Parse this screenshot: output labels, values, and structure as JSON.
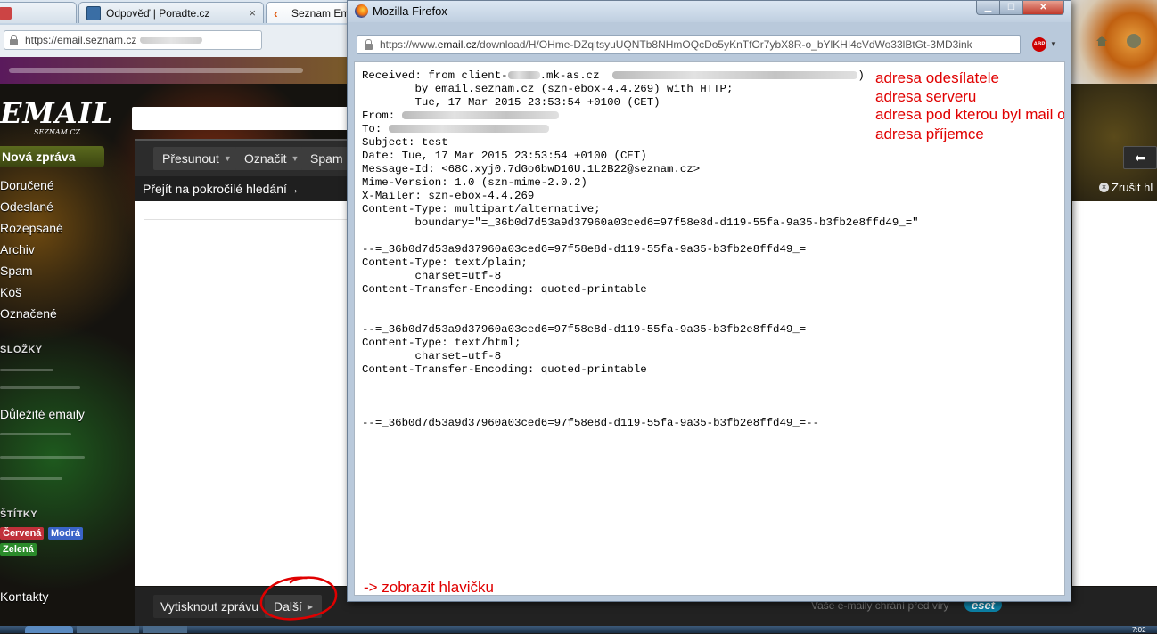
{
  "background_browser": {
    "tabs": [
      {
        "label": "",
        "favicon_color": "#cc4444"
      },
      {
        "label": "Odpověď | Poradte.cz",
        "favicon_color": "#3a6ea5"
      },
      {
        "label": "Seznam Em",
        "favicon_color": "#e05a10"
      }
    ],
    "tab_close_glyph": "×",
    "url": "https://email.seznam.cz"
  },
  "email_app": {
    "logo_main": "EMAIL",
    "logo_sub": "SEZNAM.CZ",
    "toolbar": {
      "move_label": "Přesunout",
      "mark_label": "Označit",
      "spam_label": "Spam"
    },
    "advanced_search_link": "Přejít na pokročilé hledání→",
    "cancel_search_label": "Zrušit hl",
    "new_mail_label": "Nová zpráva",
    "folders": [
      "Doručené",
      "Odeslané",
      "Rozepsané",
      "Archiv",
      "Spam",
      "Koš",
      "Označené"
    ],
    "folders_section_title": "SLOŽKY",
    "important_folder": "Důležité emaily",
    "labels_section_title": "ŠTÍTKY",
    "tags": [
      {
        "label": "Červená",
        "color": "#c0303a"
      },
      {
        "label": "Modrá",
        "color": "#3a64c8"
      },
      {
        "label": "Zelená",
        "color": "#2a8a2a"
      }
    ],
    "contacts_label": "Kontakty",
    "print_label": "Vytisknout zprávu",
    "next_label": "Další",
    "antivirus_note": "Vaše e-maily chrání před viry",
    "antivirus_brand": "eset",
    "back_glyph": "⬅",
    "cancel_glyph": "×",
    "clock": "7:02"
  },
  "popup": {
    "title": "Mozilla Firefox",
    "min_glyph": "▁",
    "max_glyph": "☐",
    "close_glyph": "✕",
    "url_prefix": "https://www.",
    "url_domain": "email.cz",
    "url_rest": "/download/H/OHme-DZqltsyuUQNTb8NHmOQcDo5yKnTfOr7ybX8R-o_bYlKHI4cVdWo33lBtGt-3MD3ink",
    "abp_label": "ABP",
    "header_lines": {
      "received_1": "Received: from client-",
      "received_1b": ".mk-as.cz",
      "received_1c": ")",
      "received_2": "        by email.seznam.cz (szn-ebox-4.4.269) with HTTP;",
      "received_3": "        Tue, 17 Mar 2015 23:53:54 +0100 (CET)",
      "from": "From: ",
      "to": "To: ",
      "subject": "Subject: test",
      "date": "Date: Tue, 17 Mar 2015 23:53:54 +0100 (CET)",
      "message_id": "Message-Id: <68C.xyj0.7dGo6bwD16U.1L2B22@seznam.cz>",
      "mime": "Mime-Version: 1.0 (szn-mime-2.0.2)",
      "mailer": "X-Mailer: szn-ebox-4.4.269",
      "ctype": "Content-Type: multipart/alternative;",
      "boundary": "        boundary=\"=_36b0d7d53a9d37960a03ced6=97f58e8d-d119-55fa-9a35-b3fb2e8ffd49_=\"",
      "part1_sep": "--=_36b0d7d53a9d37960a03ced6=97f58e8d-d119-55fa-9a35-b3fb2e8ffd49_=",
      "part1_ctype": "Content-Type: text/plain;",
      "part1_charset": "        charset=utf-8",
      "part1_cte": "Content-Transfer-Encoding: quoted-printable",
      "part2_sep": "--=_36b0d7d53a9d37960a03ced6=97f58e8d-d119-55fa-9a35-b3fb2e8ffd49_=",
      "part2_ctype": "Content-Type: text/html;",
      "part2_charset": "        charset=utf-8",
      "part2_cte": "Content-Transfer-Encoding: quoted-printable",
      "end_sep": "--=_36b0d7d53a9d37960a03ced6=97f58e8d-d119-55fa-9a35-b3fb2e8ffd49_=--"
    },
    "annotations": {
      "sender": "adresa odesílatele",
      "server": "adresa serveru",
      "sent_as": "adresa pod kterou byl mail odeslán",
      "recipient": "adresa příjemce",
      "show_header": "-> zobrazit hlavičku"
    },
    "annotation_color": "#e00000"
  }
}
